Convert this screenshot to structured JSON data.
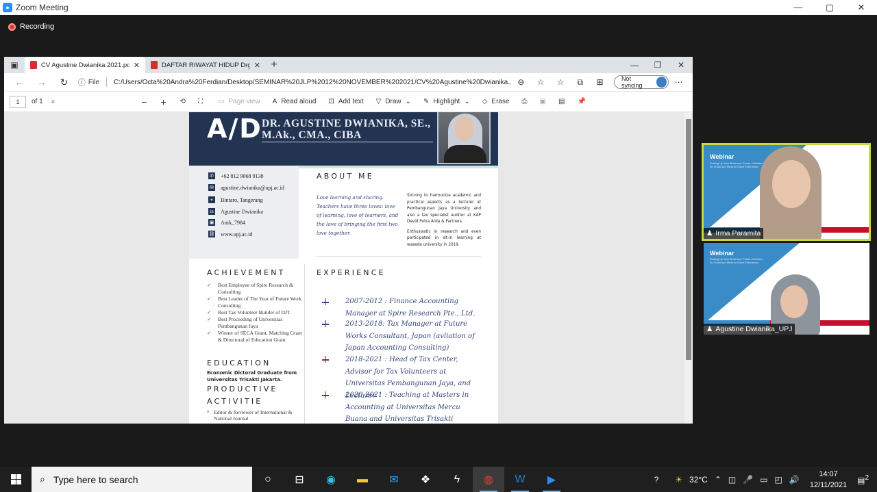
{
  "zoom": {
    "title": "Zoom Meeting",
    "recording": "Recording",
    "controls": [
      "—",
      "▢",
      "✕"
    ]
  },
  "browser": {
    "tabs": [
      {
        "label": "CV Agustine Dwianika 2021.pdf",
        "close": "✕"
      },
      {
        "label": "DAFTAR RIWAYAT HIDUP Drg. D...",
        "close": "✕"
      }
    ],
    "new_tab": "+",
    "window_controls": [
      "—",
      "❐",
      "✕"
    ],
    "file_label": "File",
    "url": "C:/Users/Octa%20Andra%20Ferdian/Desktop/SEMINAR%20JLP%2012%20NOVEMBER%202021/CV%20Agustine%20Dwianika...",
    "sync_label": "Not syncing",
    "pdf_toolbar": {
      "page_current": "1",
      "page_total": "of 1",
      "page_view": "Page view",
      "read_aloud": "Read aloud",
      "add_text": "Add text",
      "draw": "Draw",
      "highlight": "Highlight",
      "erase": "Erase"
    }
  },
  "cv": {
    "monogram": "A/D",
    "name_line1": "DR. AGUSTINE DWIANIKA, SE.,",
    "name_line2": "M.Ak., CMA., CIBA",
    "contacts": [
      {
        "icon": "✆",
        "text": "+62 812 9068 9138"
      },
      {
        "icon": "✉",
        "text": "agustine.dwianika@upj.ac.id"
      },
      {
        "icon": "⌖",
        "text": "Bintaro, Tangerang"
      },
      {
        "icon": "in",
        "text": "Agustine Dwianika"
      },
      {
        "icon": "▣",
        "text": "Anik_7984"
      },
      {
        "icon": "⛓",
        "text": "www.upj.ac.id"
      }
    ],
    "about_title": "ABOUT ME",
    "about_italic": "Love learning and sharing. Teachers have three loves: love of learning, love of learners, and the love of bringing the first two love together.",
    "about_p1": "Striving to harmonize academic and practical aspects as a lecturer at Pembangunan Jaya University and also a tax specialist auditor at KAP Devid Putra Arda & Partners.",
    "about_p2": "Enthusiastic in research and even participated in sit-in learning at waseda university in 2019.",
    "achievement_title": "ACHIEVEMENT",
    "achievements": [
      "Best Employee of Spire Research & Consulting",
      "Best Leader of The Year of Future Work Consulting",
      "Best  Tax Volunteer Builder of DJT",
      "Best Proceeding  of Universitas Pembangunan Jaya",
      "Winner of SECA Grant, Matching Grant & Directoral of Education Grant"
    ],
    "education_title": "EDUCATION",
    "education_text": "Economic Dictoral Graduate from Universitas Trisakti Jakarta.",
    "productive_title_1": "PRODUCTIVE",
    "productive_title_2": "ACTIVITIE",
    "productive": [
      "Editor & Reviewer of International & National Journal"
    ],
    "experience_title": "EXPERIENCE",
    "experience": [
      "2007-2012 : Finance Accounting Manager at Spire Research Pte., Ltd.",
      "2013-2018: Tax Manager at Future Works Consultant, Japan (avliation of Japan Accounting Consulting)",
      "2018-2021 : Head of Tax Center, Advisor for Tax Volunteers at Universitas Pembangunan Jaya, and Lecturer",
      "2020-2021 : Teaching at Masters in Accounting at Universitas Mercu Buana and Universitas Trisakti"
    ]
  },
  "participants": [
    {
      "name": "Irma Paramita",
      "webinar": "Webinar",
      "subtitle": "Scaling Up Your Business: Power of Advice for Small and Medium Sized Enterprises"
    },
    {
      "name": "Agustine Dwianika_UPJ",
      "webinar": "Webinar",
      "subtitle": "Scaling Up Your Business: Power of Advice for Small and Medium Sized Enterprises"
    }
  ],
  "taskbar": {
    "search_placeholder": "Type here to search",
    "temperature": "32°C",
    "time": "14:07",
    "date": "12/11/2021",
    "notifications": "2"
  },
  "colors": {
    "header_navy": "#233352",
    "highlight_border": "#c9d93b",
    "webinar_blue": "#3a8cc9",
    "accent_red": "#c8102e"
  }
}
